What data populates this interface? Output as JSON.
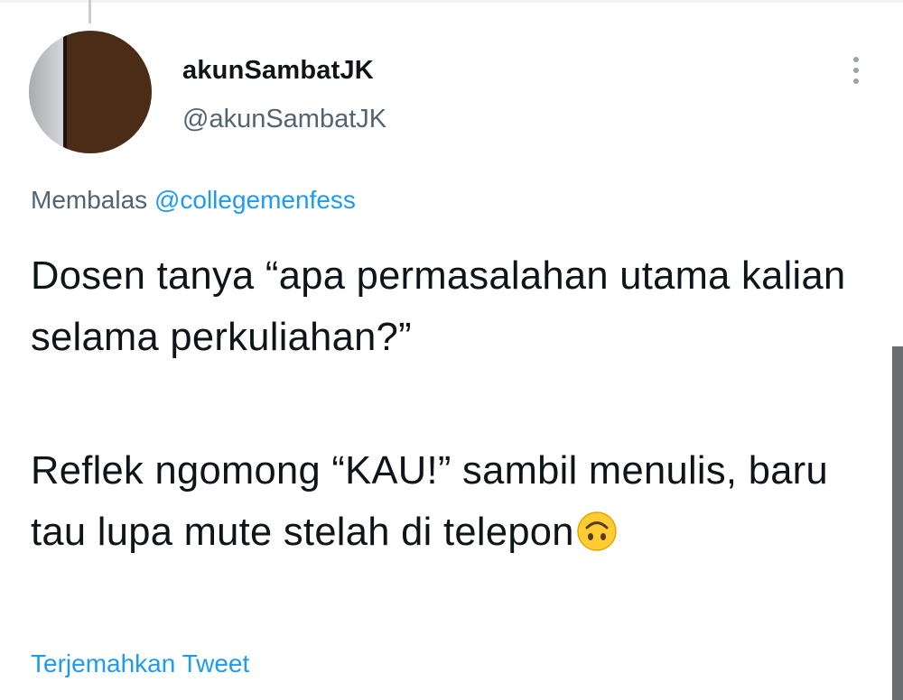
{
  "tweet": {
    "display_name": "akunSambatJK",
    "handle": "@akunSambatJK",
    "reply_prefix": "Membalas",
    "reply_mention": "@collegemenfess",
    "text_line_1": "Dosen tanya “apa permasalahan utama kalian selama perkuliahan?”",
    "text_line_2": "Reflek ngomong “KAU!” sambil menulis, baru tau lupa mute stelah di telepon",
    "emoji": "upside-down-face-emoji",
    "translate_label": "Terjemahkan Tweet"
  },
  "icons": {
    "more": "more-vertical-icon"
  },
  "colors": {
    "link": "#1d9bf0",
    "secondary_text": "#536471",
    "primary_text": "#0f1419"
  }
}
